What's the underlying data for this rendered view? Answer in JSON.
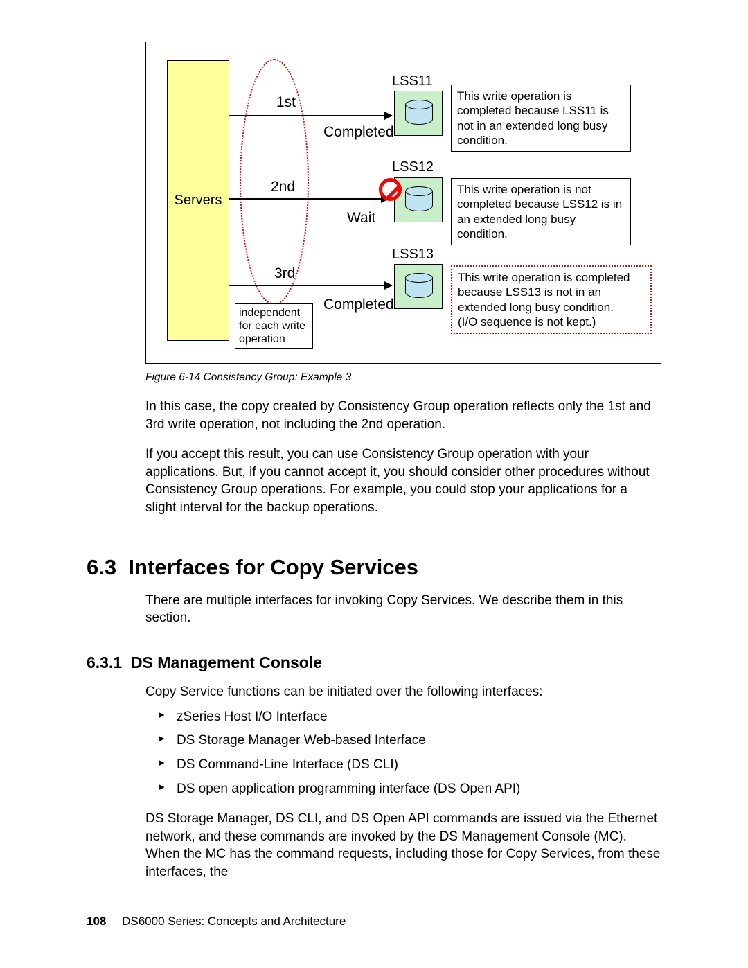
{
  "figure": {
    "servers_label": "Servers",
    "ellipse_caption": {
      "line1_underlined": "independent",
      "rest": "for each write operation"
    },
    "rows": [
      {
        "ordinal": "1st",
        "status": "Completed",
        "lss_label": "LSS11",
        "explain": "This write operation is completed because LSS11 is not in an extended long busy condition."
      },
      {
        "ordinal": "2nd",
        "status": "Wait",
        "lss_label": "LSS12",
        "explain": "This write operation is not completed because LSS12 is in an extended long busy  condition."
      },
      {
        "ordinal": "3rd",
        "status": "Completed",
        "lss_label": "LSS13",
        "explain": "This write operation is completed because LSS13 is not in an extended long busy condition.\n(I/O sequence is not kept.)"
      }
    ],
    "caption": "Figure 6-14   Consistency Group: Example 3"
  },
  "body": {
    "p1": "In this case, the copy created by Consistency Group operation reflects only the 1st and 3rd write operation, not including the 2nd operation.",
    "p2": "If you accept this result, you can use Consistency Group operation with your applications. But, if you cannot accept it, you should consider other procedures without Consistency Group operations. For example, you could stop your applications for a slight interval for the backup operations."
  },
  "section": {
    "number": "6.3",
    "title": "Interfaces for Copy Services",
    "intro": "There are multiple interfaces for invoking Copy Services. We describe them in this section."
  },
  "subsection": {
    "number": "6.3.1",
    "title": "DS Management Console",
    "intro": "Copy Service functions can be initiated over the following interfaces:",
    "bullets": [
      "zSeries Host I/O Interface",
      "DS Storage Manager Web-based Interface",
      "DS Command-Line Interface (DS CLI)",
      "DS open application programming interface (DS Open API)"
    ],
    "p_after": "DS Storage Manager, DS CLI, and DS Open API commands are issued via the Ethernet network, and these commands are invoked by the DS Management Console (MC). When the MC has the command requests, including those for Copy Services, from these interfaces, the"
  },
  "footer": {
    "page": "108",
    "book": "DS6000 Series: Concepts and Architecture"
  }
}
